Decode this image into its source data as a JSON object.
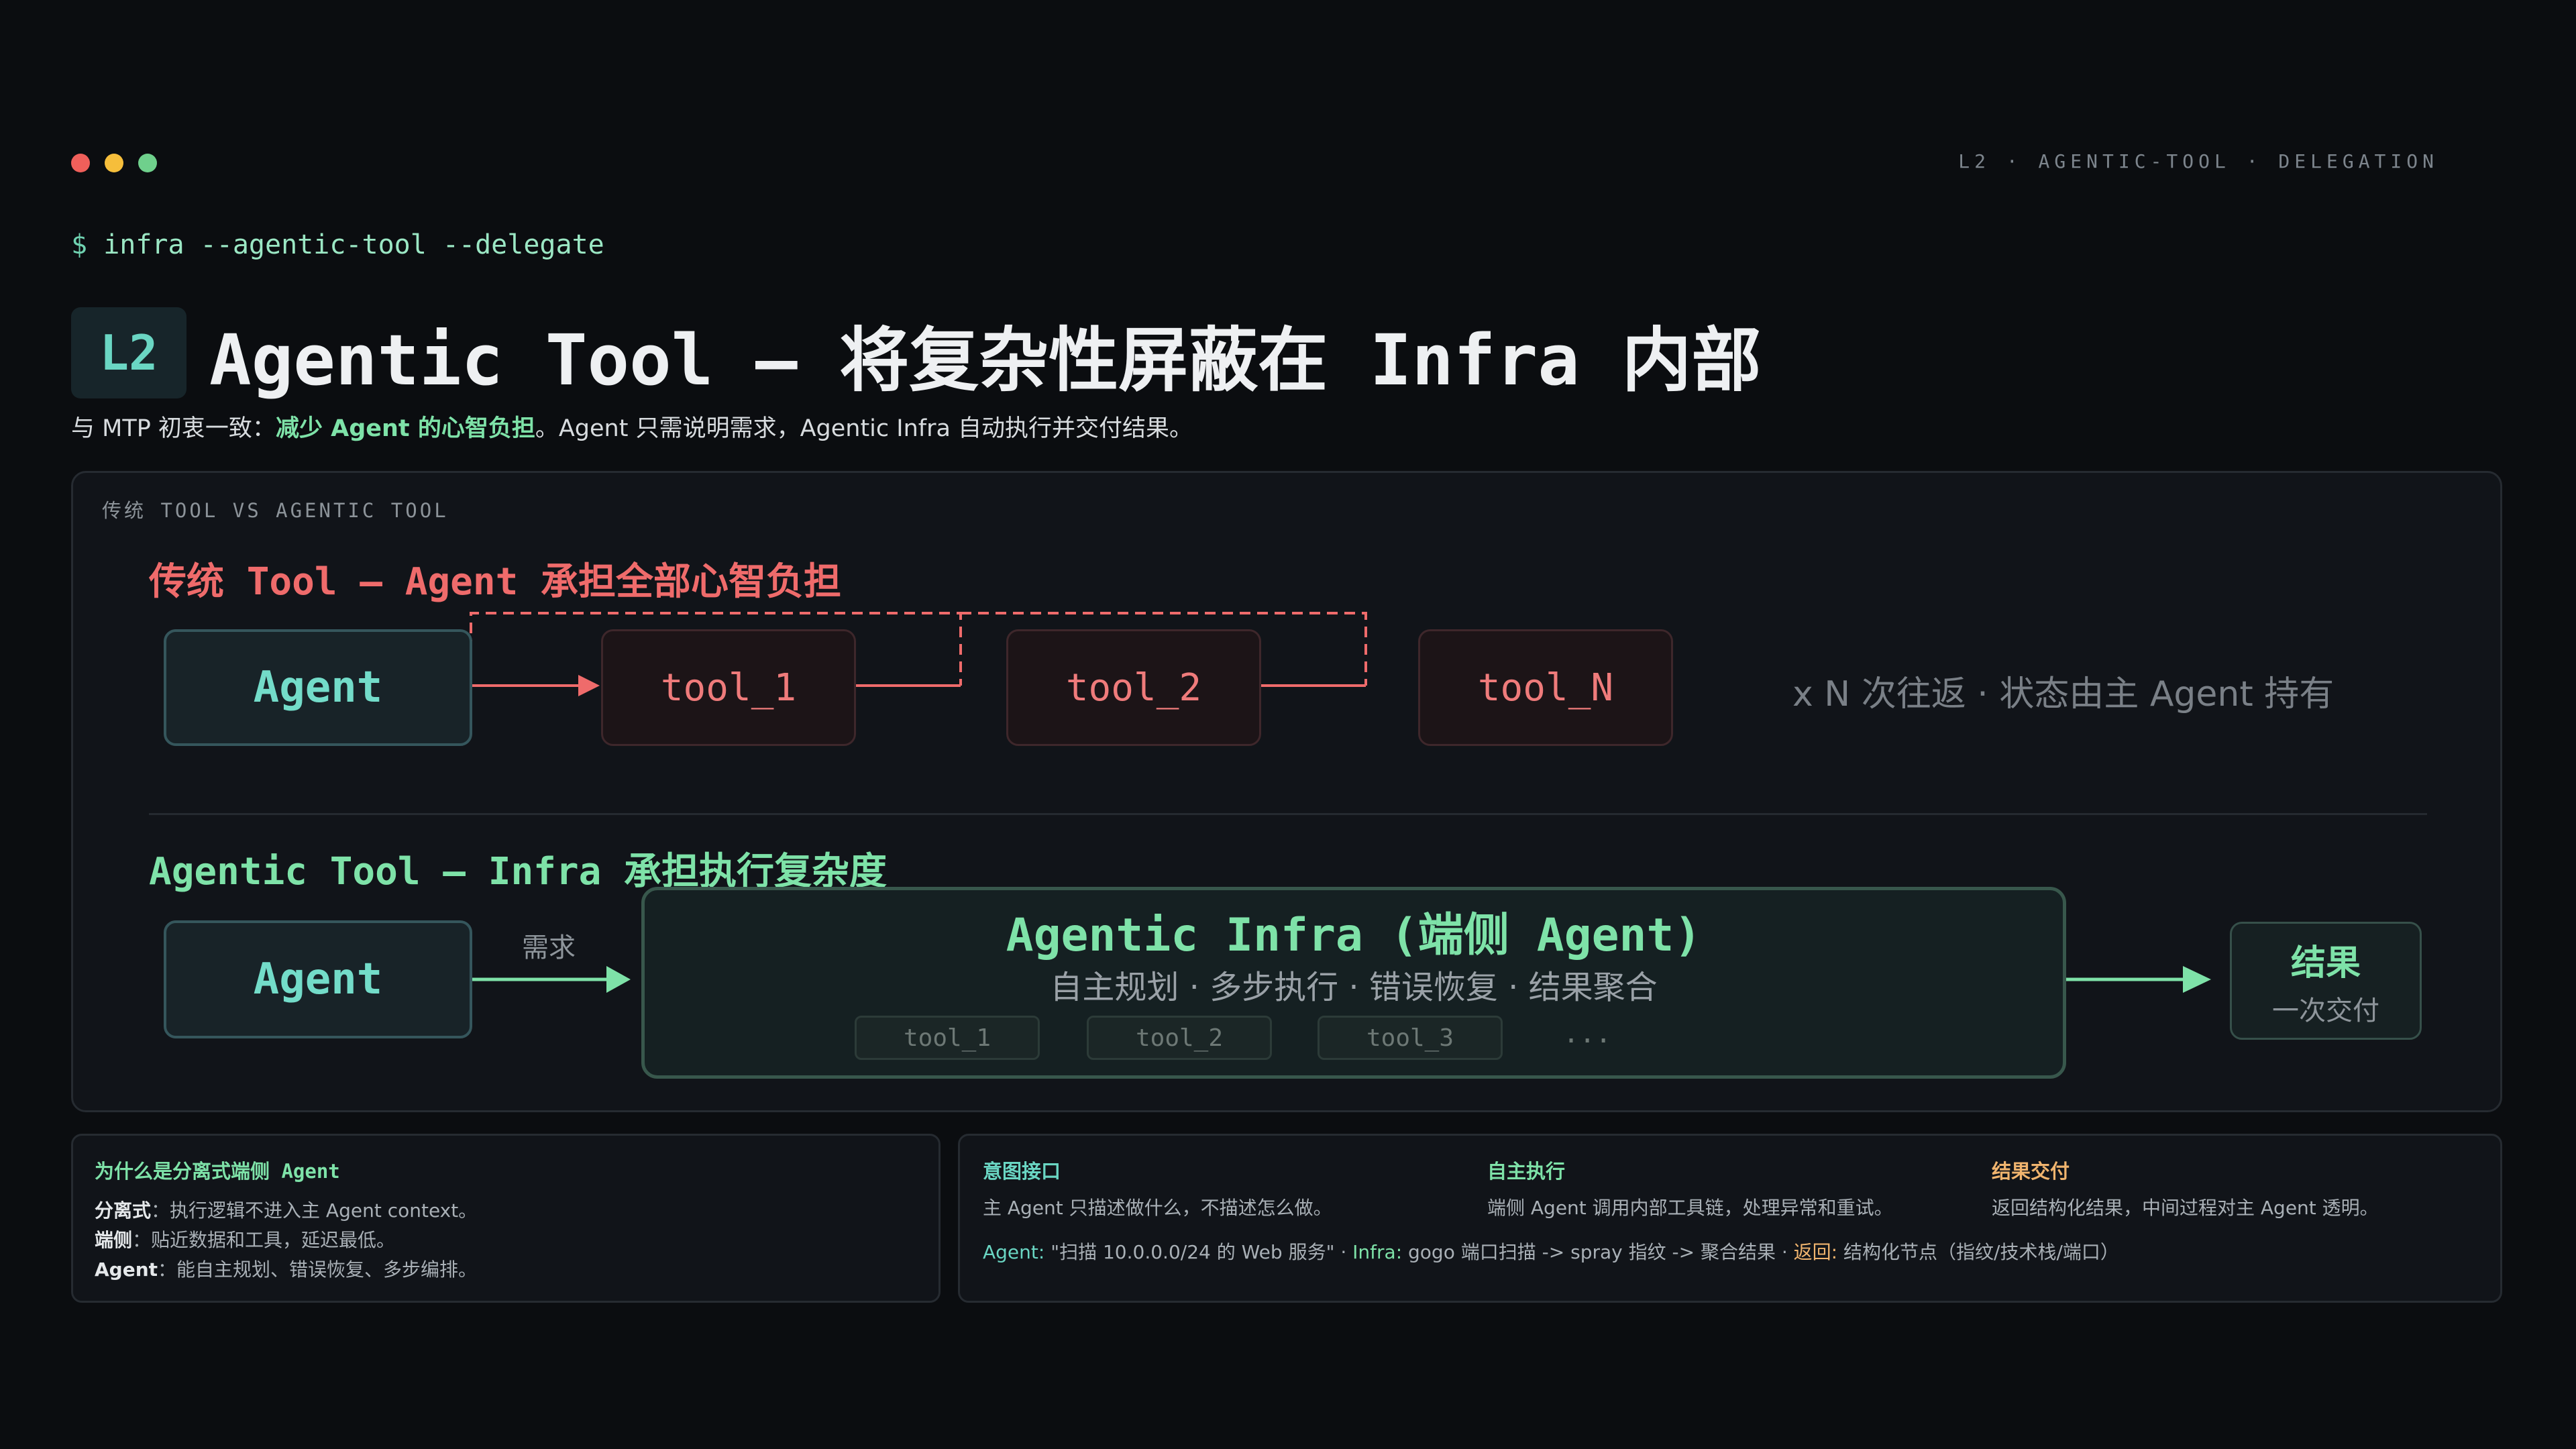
{
  "window": {
    "dot_colors": [
      "#ef5f5a",
      "#f6be3b",
      "#6fd08c"
    ],
    "breadcrumb": "L2 · AGENTIC-TOOL · DELEGATION"
  },
  "command": {
    "prompt": "$",
    "text": "infra --agentic-tool --delegate"
  },
  "header": {
    "badge": "L2",
    "title": "Agentic Tool — 将复杂性屏蔽在 Infra 内部",
    "subtitle_pre": "与 MTP 初衷一致：",
    "subtitle_highlight": "减少 Agent 的心智负担",
    "subtitle_post": "。Agent 只需说明需求，Agentic Infra 自动执行并交付结果。"
  },
  "panel": {
    "label": "传统 TOOL VS AGENTIC TOOL",
    "traditional": {
      "title": "传统 Tool — Agent 承担全部心智负担",
      "agent": "Agent",
      "tools": [
        "tool_1",
        "tool_2",
        "tool_N"
      ],
      "note": "x N 次往返 · 状态由主 Agent 持有"
    },
    "agentic": {
      "title": "Agentic Tool — Infra 承担执行复杂度",
      "agent": "Agent",
      "request_label": "需求",
      "infra_title": "Agentic Infra (端侧 Agent)",
      "infra_subtitle": "自主规划 · 多步执行 · 错误恢复 · 结果聚合",
      "infra_tools": [
        "tool_1",
        "tool_2",
        "tool_3"
      ],
      "infra_more": "...",
      "result_title": "结果",
      "result_sub": "一次交付"
    }
  },
  "cards": {
    "why": {
      "title": "为什么是分离式端侧 Agent",
      "lines": [
        {
          "key": "分离式",
          "text": "：执行逻辑不进入主 Agent context。"
        },
        {
          "key": "端侧",
          "text": "：贴近数据和工具，延迟最低。"
        },
        {
          "key": "Agent",
          "text": "：能自主规划、错误恢复、多步编排。"
        }
      ]
    },
    "intent": {
      "title": "意图接口",
      "text": "主 Agent 只描述做什么，不描述怎么做。"
    },
    "autonomy": {
      "title": "自主执行",
      "text": "端侧 Agent 调用内部工具链，处理异常和重试。"
    },
    "delivery": {
      "title": "结果交付",
      "text": "返回结构化结果，中间过程对主 Agent 透明。"
    },
    "example": {
      "agent_label": "Agent:",
      "agent_text": " \"扫描 10.0.0.0/24 的 Web 服务\" · ",
      "infra_label": "Infra:",
      "infra_text": " gogo 端口扫描 -> spray 指纹 -> 聚合结果 · ",
      "return_label": "返回:",
      "return_text": " 结构化节点（指纹/技术栈/端口）"
    }
  },
  "colors": {
    "accent_green": "#7ee2a8",
    "accent_teal": "#6ad6c3",
    "accent_red": "#ef6b6b",
    "accent_gold": "#f0b46e",
    "background": "#0b0d10"
  }
}
